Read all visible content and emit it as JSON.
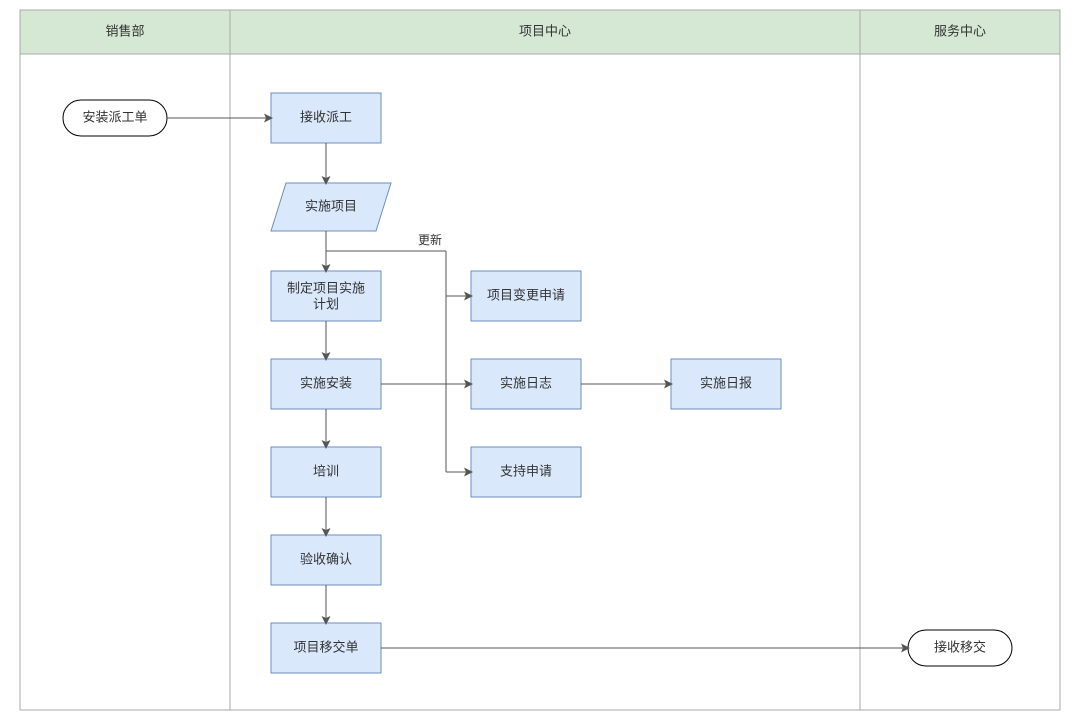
{
  "lanes": {
    "sales": {
      "label": "销售部"
    },
    "project": {
      "label": "项目中心"
    },
    "service": {
      "label": "服务中心"
    }
  },
  "nodes": {
    "dispatch_order": {
      "label": "安装派工单"
    },
    "receive_dispatch": {
      "label": "接收派工"
    },
    "impl_project": {
      "label": "实施项目"
    },
    "make_plan_l1": {
      "label": "制定项目实施"
    },
    "make_plan_l2": {
      "label": "计划"
    },
    "impl_install": {
      "label": "实施安装"
    },
    "training": {
      "label": "培训"
    },
    "accept_confirm": {
      "label": "验收确认"
    },
    "handover_order": {
      "label": "项目移交单"
    },
    "change_request": {
      "label": "项目变更申请"
    },
    "impl_log": {
      "label": "实施日志"
    },
    "impl_daily": {
      "label": "实施日报"
    },
    "support_request": {
      "label": "支持申请"
    },
    "receive_handover": {
      "label": "接收移交"
    }
  },
  "edges": {
    "update_label": "更新"
  }
}
